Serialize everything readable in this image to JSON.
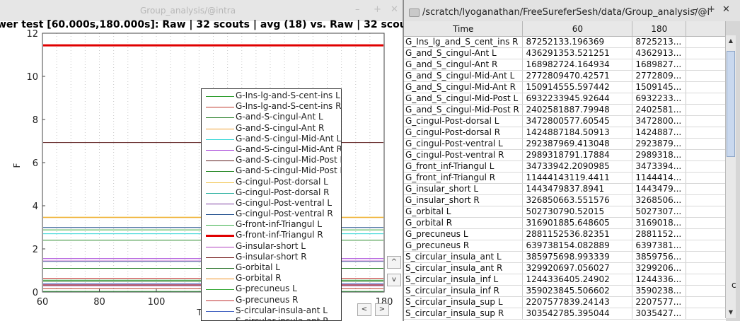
{
  "left_window": {
    "title": "Group_analysis/@intra",
    "plot_title": "wer test [60.000s,180.000s]: Raw   | 32 scouts | avg (18) vs. Raw   | 32 scouts | avg"
  },
  "right_window": {
    "title": "/scratch/lyoganathan/FreeSureferSesh/data/Group_analysis/@i",
    "columns": [
      "Time",
      "60",
      "180"
    ],
    "rows": [
      [
        "G_Ins_lg_and_S_cent_ins R",
        "87252133.196369",
        "8725213..."
      ],
      [
        "G_and_S_cingul-Ant L",
        "436291353.521251",
        "4362913..."
      ],
      [
        "G_and_S_cingul-Ant R",
        "168982724.164934",
        "1689827..."
      ],
      [
        "G_and_S_cingul-Mid-Ant L",
        "2772809470.42571",
        "2772809..."
      ],
      [
        "G_and_S_cingul-Mid-Ant R",
        "150914555.597442",
        "1509145..."
      ],
      [
        "G_and_S_cingul-Mid-Post L",
        "6932233945.92644",
        "6932233..."
      ],
      [
        "G_and_S_cingul-Mid-Post R",
        "2402581887.79948",
        "2402581..."
      ],
      [
        "G_cingul-Post-dorsal L",
        "3472800577.60545",
        "3472800..."
      ],
      [
        "G_cingul-Post-dorsal R",
        "1424887184.50913",
        "1424887..."
      ],
      [
        "G_cingul-Post-ventral L",
        "292387969.413048",
        "2923879..."
      ],
      [
        "G_cingul-Post-ventral R",
        "2989318791.17884",
        "2989318..."
      ],
      [
        "G_front_inf-Triangul L",
        "34733942.2090985",
        "3473394..."
      ],
      [
        "G_front_inf-Triangul R",
        "11444143119.4411",
        "1144414..."
      ],
      [
        "G_insular_short L",
        "1443479837.8941",
        "1443479..."
      ],
      [
        "G_insular_short R",
        "326850663.551576",
        "3268506..."
      ],
      [
        "G_orbital L",
        "502730790.52015",
        "5027307..."
      ],
      [
        "G_orbital R",
        "316901885.648605",
        "3169018..."
      ],
      [
        "G_precuneus L",
        "2881152536.82351",
        "2881152..."
      ],
      [
        "G_precuneus R",
        "639738154.082889",
        "6397381..."
      ],
      [
        "S_circular_insula_ant L",
        "385975698.993339",
        "3859756..."
      ],
      [
        "S_circular_insula_ant R",
        "329920697.056027",
        "3299206..."
      ],
      [
        "S_circular_insula_inf L",
        "1244336405.24902",
        "1244336..."
      ],
      [
        "S_circular_insula_inf R",
        "359023845.506602",
        "3590238..."
      ],
      [
        "S_circular_insula_sup L",
        "2207577839.24143",
        "2207577..."
      ],
      [
        "S_circular_insula_sup R",
        "303542785.395044",
        "3035427..."
      ]
    ],
    "status_char": "c"
  },
  "chart_data": {
    "type": "line",
    "title": "wer test [60.000s,180.000s]: Raw   | 32 scouts | avg (18) vs. Raw   | 32 scouts | avg",
    "xlabel": "T",
    "ylabel": "F",
    "xlim": [
      60,
      180
    ],
    "ylim": [
      0,
      12
    ],
    "xticks": [
      "60",
      "80",
      "100",
      "180"
    ],
    "yticks": [
      "0",
      "2",
      "4",
      "6",
      "8",
      "10",
      "12"
    ],
    "grid": "vertical-dotted",
    "legend_position": "lower-right",
    "series": [
      {
        "name": "G-Ins-lg-and-S-cent-ins L",
        "color": "#2e9e2e",
        "y": 0.55
      },
      {
        "name": "G-Ins-lg-and-S-cent-ins R",
        "color": "#c0392b",
        "y": 0.15
      },
      {
        "name": "G-and-S-cingul-Ant L",
        "color": "#1f7a1f",
        "y": 1.1
      },
      {
        "name": "G-and-S-cingul-Ant R",
        "color": "#f0a030",
        "y": 3.45
      },
      {
        "name": "G-and-S-cingul-Mid-Ant L",
        "color": "#2ad4d4",
        "y": 2.7
      },
      {
        "name": "G-and-S-cingul-Mid-Ant R",
        "color": "#a23ad6",
        "y": 1.55
      },
      {
        "name": "G-and-S-cingul-Mid-Post L",
        "color": "#5a1a1a",
        "y": 6.93
      },
      {
        "name": "G-and-S-cingul-Mid-Post R",
        "color": "#2a8a2a",
        "y": 2.4
      },
      {
        "name": "G-cingul-Post-dorsal L",
        "color": "#f0c040",
        "y": 3.47
      },
      {
        "name": "G-cingul-Post-dorsal R",
        "color": "#2ab0a0",
        "y": 1.42
      },
      {
        "name": "G-cingul-Post-ventral L",
        "color": "#7a3aa0",
        "y": 0.29
      },
      {
        "name": "G-cingul-Post-ventral R",
        "color": "#1a4a8a",
        "y": 2.99
      },
      {
        "name": "G-front-inf-Triangul L",
        "color": "#3ab04a",
        "y": 0.03
      },
      {
        "name": "G-front-inf-Triangul R",
        "color": "#e00000",
        "y": 11.44
      },
      {
        "name": "G-insular-short L",
        "color": "#b040c0",
        "y": 1.44
      },
      {
        "name": "G-insular-short R",
        "color": "#6a0a0a",
        "y": 0.33
      },
      {
        "name": "G-orbital L",
        "color": "#1a6a1a",
        "y": 0.5
      },
      {
        "name": "G-orbital R",
        "color": "#f09020",
        "y": 0.32
      },
      {
        "name": "G-precuneus L",
        "color": "#3aaa3a",
        "y": 2.88
      },
      {
        "name": "G-precuneus R",
        "color": "#c03030",
        "y": 0.64
      },
      {
        "name": "S-circular-insula-ant L",
        "color": "#4060c0",
        "y": 0.39
      },
      {
        "name": "S-circular-insula-ant R",
        "color": "#a02050",
        "y": 0.33
      }
    ]
  }
}
